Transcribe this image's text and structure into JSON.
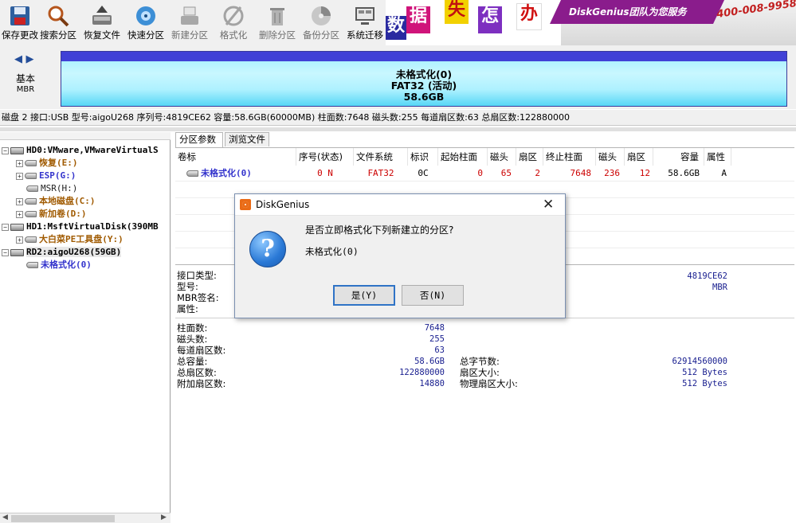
{
  "toolbar": {
    "items": [
      {
        "label": "保存更改",
        "icon": "save-icon",
        "disabled": false
      },
      {
        "label": "搜索分区",
        "icon": "search-partition-icon",
        "disabled": false
      },
      {
        "label": "恢复文件",
        "icon": "recover-files-icon",
        "disabled": false
      },
      {
        "label": "快速分区",
        "icon": "quick-partition-icon",
        "disabled": false
      },
      {
        "label": "新建分区",
        "icon": "new-partition-icon",
        "disabled": true
      },
      {
        "label": "格式化",
        "icon": "format-icon",
        "disabled": true
      },
      {
        "label": "删除分区",
        "icon": "delete-partition-icon",
        "disabled": true
      },
      {
        "label": "备份分区",
        "icon": "backup-partition-icon",
        "disabled": true
      },
      {
        "label": "系统迁移",
        "icon": "system-migrate-icon",
        "disabled": false
      }
    ]
  },
  "banner": {
    "chars": [
      "数",
      "据",
      "失",
      "怎",
      "办"
    ],
    "slogan": "DiskGenius团队为您服务",
    "phone": "400-008-9958"
  },
  "diskbar": {
    "basic_line1": "基本",
    "basic_line2": "MBR",
    "partition_name": "未格式化(0)",
    "partition_fs": "FAT32 (活动)",
    "partition_size": "58.6GB"
  },
  "infobar": {
    "text": "磁盘 2 接口:USB  型号:aigoU268  序列号:4819CE62  容量:58.6GB(60000MB)  柱面数:7648  磁头数:255  每道扇区数:63  总扇区数:122880000"
  },
  "tree": {
    "nodes": [
      {
        "label": "HD0:VMware,VMwareVirtualS",
        "type": "disk",
        "color": "#000000"
      },
      {
        "label": "恢复(E:)",
        "type": "part",
        "color": "#a05a00"
      },
      {
        "label": "ESP(G:)",
        "type": "part",
        "color": "#3333cc"
      },
      {
        "label": "MSR(H:)",
        "type": "part",
        "color": "#222222"
      },
      {
        "label": "本地磁盘(C:)",
        "type": "part",
        "color": "#a05a00"
      },
      {
        "label": "新加卷(D:)",
        "type": "part",
        "color": "#a05a00"
      },
      {
        "label": "HD1:MsftVirtualDisk(390MB",
        "type": "disk",
        "color": "#000000"
      },
      {
        "label": "大白菜PE工具盘(Y:)",
        "type": "part",
        "color": "#a05a00"
      },
      {
        "label": "RD2:aigoU268(59GB)",
        "type": "disk",
        "color": "#000000"
      },
      {
        "label": "未格式化(0)",
        "type": "part",
        "color": "#3333cc"
      }
    ]
  },
  "tabs": [
    "分区参数",
    "浏览文件"
  ],
  "table": {
    "headers": [
      "卷标",
      "序号(状态)",
      "文件系统",
      "标识",
      "起始柱面",
      "磁头",
      "扇区",
      "终止柱面",
      "磁头",
      "扇区",
      "容量",
      "属性"
    ],
    "row": [
      "未格式化(0)",
      "0 N",
      "FAT32",
      "0C",
      "0",
      "65",
      "2",
      "7648",
      "236",
      "12",
      "58.6GB",
      "A"
    ]
  },
  "props_top": {
    "labels": [
      "接口类型:",
      "型号:",
      "MBR签名:",
      "属性:"
    ],
    "serial": "4819CE62",
    "mbr": "MBR"
  },
  "props_bottom": {
    "left": [
      {
        "label": "柱面数:",
        "value": "7648"
      },
      {
        "label": "磁头数:",
        "value": "255"
      },
      {
        "label": "每道扇区数:",
        "value": "63"
      },
      {
        "label": "总容量:",
        "value": "58.6GB"
      },
      {
        "label": "总扇区数:",
        "value": "122880000"
      },
      {
        "label": "附加扇区数:",
        "value": "14880"
      }
    ],
    "right": [
      {
        "label": "总字节数:",
        "value": "62914560000"
      },
      {
        "label": "扇区大小:",
        "value": "512 Bytes"
      },
      {
        "label": "物理扇区大小:",
        "value": "512 Bytes"
      }
    ]
  },
  "dialog": {
    "title": "DiskGenius",
    "question": "是否立即格式化下列新建立的分区?",
    "partition": "未格式化(0)",
    "yes": "是(Y)",
    "no": "否(N)"
  }
}
